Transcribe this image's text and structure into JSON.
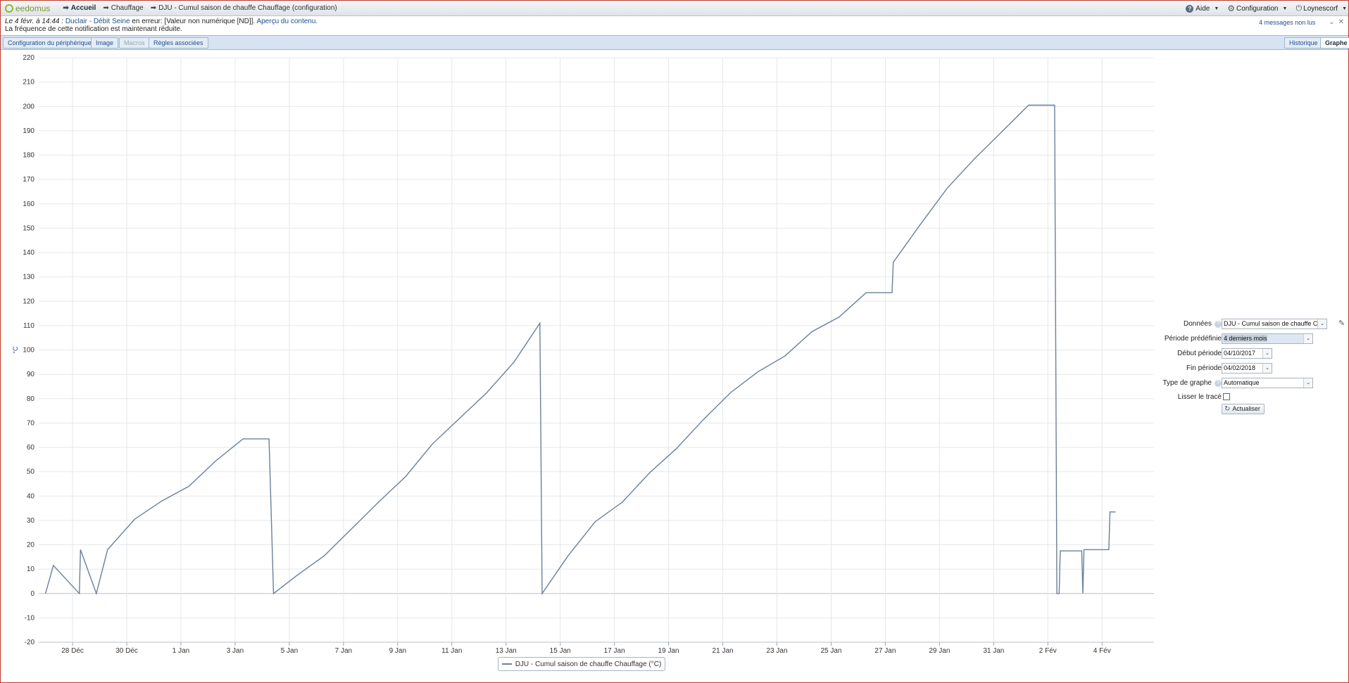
{
  "app": {
    "logo_text": "eedomus",
    "breadcrumbs": [
      {
        "label": "Accueil"
      },
      {
        "label": "Chauffage"
      },
      {
        "label": "DJU - Cumul saison de chauffe Chauffage (configuration)"
      }
    ],
    "top_right": {
      "help": "Aide",
      "configuration": "Configuration",
      "user": "Loynescorf"
    }
  },
  "notification": {
    "when": "Le 4 févr. à 14:44 :",
    "device": "Duclair - Débit Seine",
    "middle": " en erreur: [Valeur non numérique [ND]]. ",
    "preview_link": "Aperçu du contenu.",
    "line2": "La fréquence de cette notification est maintenant réduite.",
    "unread": "4 messages non lus"
  },
  "tabs": [
    {
      "label": "Configuration du périphérique",
      "state": "normal"
    },
    {
      "label": "Image",
      "state": "normal"
    },
    {
      "label": "Macros",
      "state": "disabled"
    },
    {
      "label": "Règles associées",
      "state": "normal"
    },
    {
      "label": "Historique",
      "state": "normal"
    },
    {
      "label": "Graphe",
      "state": "active"
    }
  ],
  "chart_data": {
    "type": "line",
    "xlabel": "",
    "ylabel": "°C",
    "ylim": [
      -20,
      220
    ],
    "yticks": [
      -20,
      -10,
      0,
      10,
      20,
      30,
      40,
      50,
      60,
      70,
      80,
      90,
      100,
      110,
      120,
      130,
      140,
      150,
      160,
      170,
      180,
      190,
      200,
      210,
      220
    ],
    "xlim": [
      "2017-12-26T18:00",
      "2018-02-05T22:00"
    ],
    "xticks": [
      {
        "x": "2017-12-28",
        "label": "28 Déc"
      },
      {
        "x": "2017-12-30",
        "label": "30 Déc"
      },
      {
        "x": "2018-01-01",
        "label": "1 Jan"
      },
      {
        "x": "2018-01-03",
        "label": "3 Jan"
      },
      {
        "x": "2018-01-05",
        "label": "5 Jan"
      },
      {
        "x": "2018-01-07",
        "label": "7 Jan"
      },
      {
        "x": "2018-01-09",
        "label": "9 Jan"
      },
      {
        "x": "2018-01-11",
        "label": "11 Jan"
      },
      {
        "x": "2018-01-13",
        "label": "13 Jan"
      },
      {
        "x": "2018-01-15",
        "label": "15 Jan"
      },
      {
        "x": "2018-01-17",
        "label": "17 Jan"
      },
      {
        "x": "2018-01-19",
        "label": "19 Jan"
      },
      {
        "x": "2018-01-21",
        "label": "21 Jan"
      },
      {
        "x": "2018-01-23",
        "label": "23 Jan"
      },
      {
        "x": "2018-01-25",
        "label": "25 Jan"
      },
      {
        "x": "2018-01-27",
        "label": "27 Jan"
      },
      {
        "x": "2018-01-29",
        "label": "29 Jan"
      },
      {
        "x": "2018-01-31",
        "label": "31 Jan"
      },
      {
        "x": "2018-02-02",
        "label": "2 Fév"
      },
      {
        "x": "2018-02-04",
        "label": "4 Fév"
      }
    ],
    "grid": true,
    "legend_position": "bottom-center",
    "series": [
      {
        "name": "DJU - Cumul saison de chauffe Chauffage (°C)",
        "color": "#6b7f99",
        "points": [
          [
            "2017-12-27T00:00",
            0
          ],
          [
            "2017-12-27T07:00",
            11.5
          ],
          [
            "2017-12-28T06:00",
            0
          ],
          [
            "2017-12-28T07:00",
            18
          ],
          [
            "2017-12-28T21:00",
            0
          ],
          [
            "2017-12-29T07:00",
            18
          ],
          [
            "2017-12-30T07:00",
            30.5
          ],
          [
            "2017-12-31T07:00",
            38
          ],
          [
            "2018-01-01T07:00",
            44
          ],
          [
            "2018-01-02T07:00",
            54.5
          ],
          [
            "2018-01-03T07:00",
            63.5
          ],
          [
            "2018-01-04T06:00",
            63.5
          ],
          [
            "2018-01-04T10:00",
            0
          ],
          [
            "2018-01-05T07:00",
            7.5
          ],
          [
            "2018-01-06T07:00",
            15.5
          ],
          [
            "2018-01-07T07:00",
            26.5
          ],
          [
            "2018-01-08T07:00",
            37.5
          ],
          [
            "2018-01-09T07:00",
            48
          ],
          [
            "2018-01-10T07:00",
            61.5
          ],
          [
            "2018-01-11T07:00",
            72
          ],
          [
            "2018-01-12T07:00",
            82.5
          ],
          [
            "2018-01-13T07:00",
            95
          ],
          [
            "2018-01-14T06:00",
            111
          ],
          [
            "2018-01-14T08:00",
            0
          ],
          [
            "2018-01-15T07:00",
            15.5
          ],
          [
            "2018-01-16T07:00",
            29.5
          ],
          [
            "2018-01-17T07:00",
            37.5
          ],
          [
            "2018-01-18T07:00",
            49.5
          ],
          [
            "2018-01-19T07:00",
            59.5
          ],
          [
            "2018-01-20T07:00",
            71.5
          ],
          [
            "2018-01-21T07:00",
            82.5
          ],
          [
            "2018-01-22T07:00",
            91
          ],
          [
            "2018-01-23T07:00",
            97.5
          ],
          [
            "2018-01-24T07:00",
            107.5
          ],
          [
            "2018-01-25T07:00",
            113.5
          ],
          [
            "2018-01-26T07:00",
            123.5
          ],
          [
            "2018-01-27T06:00",
            123.5
          ],
          [
            "2018-01-27T07:00",
            136
          ],
          [
            "2018-01-28T07:00",
            151.5
          ],
          [
            "2018-01-29T07:00",
            166.5
          ],
          [
            "2018-01-30T07:00",
            178.5
          ],
          [
            "2018-01-31T07:00",
            189.5
          ],
          [
            "2018-02-01T07:00",
            200.5
          ],
          [
            "2018-02-02T06:00",
            200.5
          ],
          [
            "2018-02-02T08:00",
            0
          ],
          [
            "2018-02-02T10:00",
            0
          ],
          [
            "2018-02-02T11:00",
            17.5
          ],
          [
            "2018-02-03T06:00",
            17.5
          ],
          [
            "2018-02-03T07:00",
            0
          ],
          [
            "2018-02-03T08:00",
            18
          ],
          [
            "2018-02-04T06:00",
            18
          ],
          [
            "2018-02-04T07:00",
            33.5
          ],
          [
            "2018-02-04T12:00",
            33.5
          ]
        ]
      }
    ]
  },
  "settings": {
    "data_label": "Données",
    "data_value": "DJU - Cumul saison de chauffe Chauffage (°C)",
    "period_label": "Période prédéfinie",
    "period_value": "4 derniers mois",
    "start_label": "Début période",
    "start_value": "04/10/2017",
    "end_label": "Fin période",
    "end_value": "04/02/2018",
    "graph_type_label": "Type de graphe",
    "graph_type_value": "Automatique",
    "smooth_label": "Lisser le tracé",
    "smooth_checked": false,
    "refresh_label": "Actualiser"
  }
}
